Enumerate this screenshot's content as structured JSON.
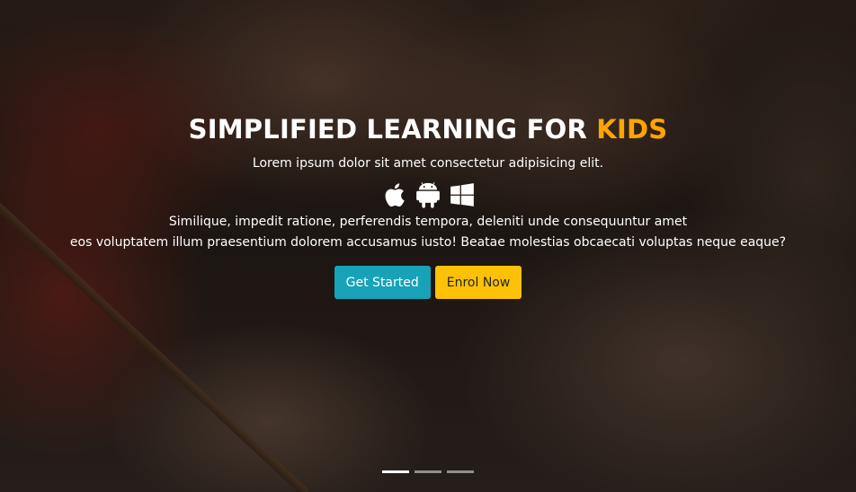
{
  "hero": {
    "title_main": "SIMPLIFIED LEARNING FOR ",
    "title_accent": "KIDS",
    "lead": "Lorem ipsum dolor sit amet consectetur adipisicing elit.",
    "platform_icons": [
      "apple-icon",
      "android-icon",
      "windows-icon"
    ],
    "body_line1": "Similique, impedit ratione, perferendis tempora, deleniti unde consequuntur amet",
    "body_line2": "eos voluptatem illum praesentium dolorem accusamus iusto! Beatae molestias obcaecati voluptas neque eaque?",
    "primary_button": "Get Started",
    "secondary_button": "Enrol Now"
  },
  "carousel": {
    "slide_count": 3,
    "active_index": 0
  },
  "colors": {
    "accent": "#ffa500",
    "primary": "#17a2b8",
    "warning": "#ffc107",
    "text": "#ffffff"
  }
}
